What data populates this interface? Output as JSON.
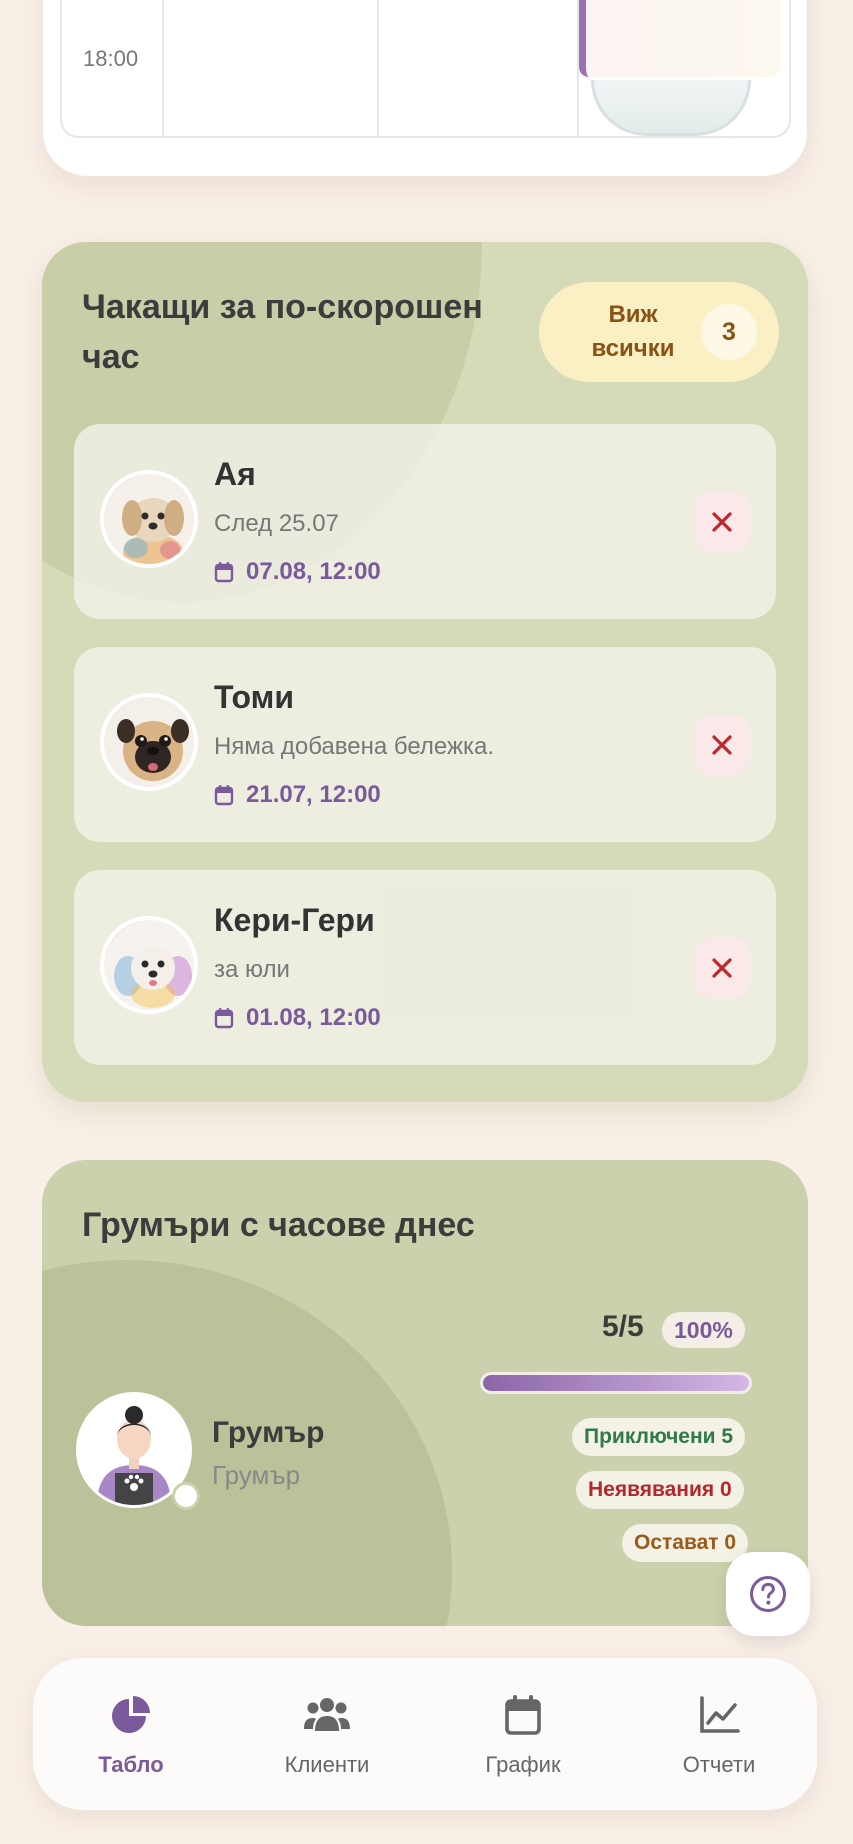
{
  "calendar": {
    "time_label": "18:00"
  },
  "waitlist": {
    "title": "Чакащи за по-скорошен час",
    "view_all_label": "Виж всички",
    "count": "3",
    "items": [
      {
        "name": "Ая",
        "note": "След 25.07",
        "date": "07.08, 12:00",
        "avatar": "dog-avatar-maltipoo"
      },
      {
        "name": "Томи",
        "note": "Няма добавена бележка.",
        "date": "21.07, 12:00",
        "avatar": "dog-avatar-pug"
      },
      {
        "name": "Кери-Гери",
        "note": "за юли",
        "date": "01.08, 12:00",
        "avatar": "dog-avatar-maltese"
      }
    ]
  },
  "groomers": {
    "title": "Грумъри с часове днес",
    "items": [
      {
        "name": "Грумър",
        "role": "Грумър",
        "ratio": "5/5",
        "percent": "100%",
        "progress_fraction": 1.0,
        "completed": "Приключени 5",
        "no_shows": "Неявявания 0",
        "remaining": "Остават 0"
      }
    ]
  },
  "nav": {
    "items": [
      {
        "label": "Табло",
        "icon": "pie-chart-icon",
        "active": true
      },
      {
        "label": "Клиенти",
        "icon": "users-icon",
        "active": false
      },
      {
        "label": "График",
        "icon": "calendar-icon",
        "active": false
      },
      {
        "label": "Отчети",
        "icon": "line-chart-icon",
        "active": false
      }
    ]
  },
  "colors": {
    "accent": "#7a5a9a",
    "success": "#2f7a46",
    "danger": "#b4282d",
    "warning": "#9a5a1a"
  }
}
